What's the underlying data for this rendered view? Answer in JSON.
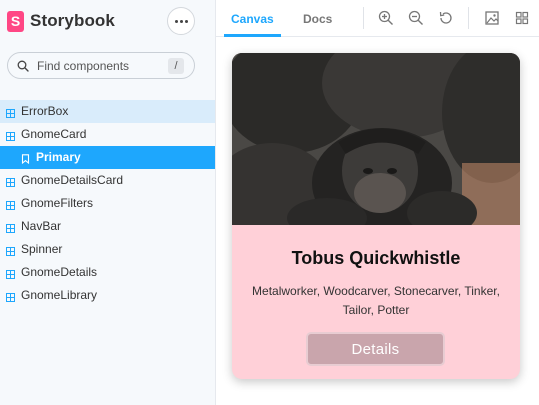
{
  "brand": {
    "name": "Storybook",
    "logo_letter": "S",
    "accent": "#ff4785"
  },
  "search": {
    "placeholder": "Find components",
    "shortcut": "/"
  },
  "sidebar": {
    "items": [
      {
        "label": "ErrorBox",
        "type": "component",
        "state": "hover"
      },
      {
        "label": "GnomeCard",
        "type": "component",
        "state": "expanded"
      },
      {
        "label": "Primary",
        "type": "story",
        "state": "selected"
      },
      {
        "label": "GnomeDetailsCard",
        "type": "component"
      },
      {
        "label": "GnomeFilters",
        "type": "component"
      },
      {
        "label": "NavBar",
        "type": "component"
      },
      {
        "label": "Spinner",
        "type": "component"
      },
      {
        "label": "GnomeDetails",
        "type": "component"
      },
      {
        "label": "GnomeLibrary",
        "type": "component"
      }
    ],
    "selected_color": "#1ea7fd"
  },
  "toolbar": {
    "tabs": [
      {
        "label": "Canvas",
        "active": true
      },
      {
        "label": "Docs",
        "active": false
      }
    ],
    "tools": [
      "zoom-in-icon",
      "zoom-out-icon",
      "reset-zoom-icon",
      "background-icon",
      "grid-icon"
    ]
  },
  "card": {
    "name": "Tobus Quickwhistle",
    "professions": "Metalworker, Woodcarver, Stonecarver, Tinker, Tailor, Potter",
    "button_label": "Details",
    "background": "#ffd0d8"
  }
}
